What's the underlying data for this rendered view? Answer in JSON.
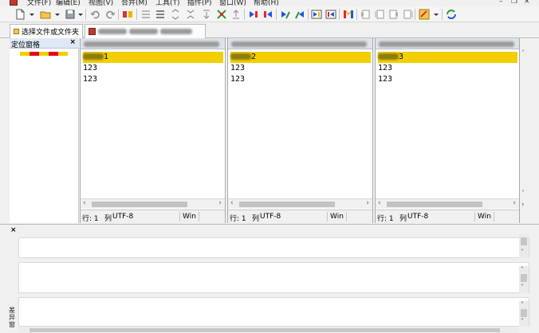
{
  "menubar": {
    "items": [
      "文件(F)",
      "编辑(E)",
      "视图(V)",
      "合并(M)",
      "工具(T)",
      "插件(P)",
      "窗口(W)",
      "帮助(H)"
    ]
  },
  "tabs": {
    "browse_label": "选择文件或文件夹"
  },
  "location_pane": {
    "title": "定位窗格",
    "close": "×"
  },
  "panes": [
    {
      "lines": [
        "1",
        "123",
        "123"
      ],
      "status": {
        "line": "行: 1",
        "col": "列",
        "encoding": "UTF-8",
        "eol": "Win"
      }
    },
    {
      "lines": [
        "2",
        "123",
        "123"
      ],
      "status": {
        "line": "行: 1",
        "col": "列",
        "encoding": "UTF-8",
        "eol": "Win"
      }
    },
    {
      "lines": [
        "3",
        "123",
        "123"
      ],
      "status": {
        "line": "行: 1",
        "col": "列",
        "encoding": "UTF-8",
        "eol": "Win"
      }
    }
  ],
  "bottom_panel": {
    "close": "×",
    "side_label": "差异窗"
  },
  "colors": {
    "highlight": "#f2cf00",
    "diff_red": "#e8001c",
    "diff_yellow": "#f2cf00"
  }
}
